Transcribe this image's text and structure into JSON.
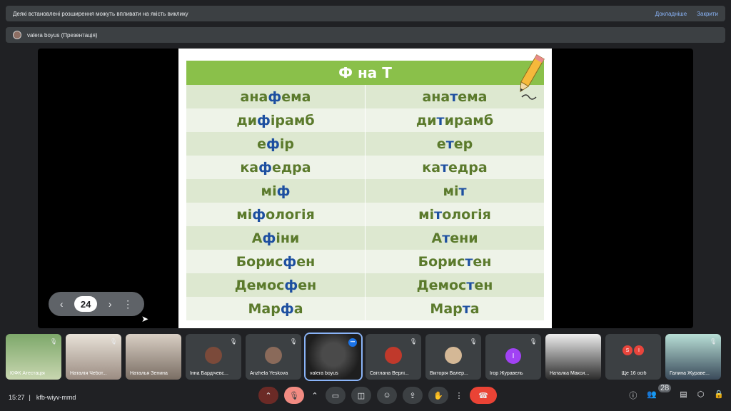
{
  "notice": {
    "message": "Деякі встановлені розширення можуть впливати на якість виклику",
    "details": "Докладніше",
    "close": "Закрити"
  },
  "presenter": {
    "label": "valera boyus (Презентація)"
  },
  "slide": {
    "title": "Ф на Т",
    "rows": [
      {
        "left_pre": "ана",
        "left_hl": "ф",
        "left_post": "ема",
        "right_pre": "ана",
        "right_hl": "т",
        "right_post": "ема"
      },
      {
        "left_pre": "ди",
        "left_hl": "ф",
        "left_post": "ірамб",
        "right_pre": "ди",
        "right_hl": "т",
        "right_post": "ирамб"
      },
      {
        "left_pre": "е",
        "left_hl": "ф",
        "left_post": "ір",
        "right_pre": "е",
        "right_hl": "т",
        "right_post": "ер"
      },
      {
        "left_pre": "ка",
        "left_hl": "ф",
        "left_post": "едра",
        "right_pre": "ка",
        "right_hl": "т",
        "right_post": "едра"
      },
      {
        "left_pre": "мі",
        "left_hl": "ф",
        "left_post": "",
        "right_pre": "мі",
        "right_hl": "т",
        "right_post": ""
      },
      {
        "left_pre": "мі",
        "left_hl": "ф",
        "left_post": "ологія",
        "right_pre": "мі",
        "right_hl": "т",
        "right_post": "ологія"
      },
      {
        "left_pre": "А",
        "left_hl": "ф",
        "left_post": "іни",
        "right_pre": "А",
        "right_hl": "т",
        "right_post": "ени"
      },
      {
        "left_pre": "Борис",
        "left_hl": "ф",
        "left_post": "ен",
        "right_pre": "Борис",
        "right_hl": "т",
        "right_post": "ен"
      },
      {
        "left_pre": "Демос",
        "left_hl": "ф",
        "left_post": "ен",
        "right_pre": "Демос",
        "right_hl": "т",
        "right_post": "ен"
      },
      {
        "left_pre": "Мар",
        "left_hl": "ф",
        "left_post": "а",
        "right_pre": "Мар",
        "right_hl": "т",
        "right_post": "а"
      }
    ]
  },
  "pager": {
    "page": "24",
    "prev_icon": "chevron-left-icon",
    "next_icon": "chevron-right-icon",
    "menu_icon": "more-vert-icon"
  },
  "participants": [
    {
      "name": "КІФК Атестація"
    },
    {
      "name": "Наталія Чебот..."
    },
    {
      "name": "Наталья Зенина"
    },
    {
      "name": "Інна Бардічевс..."
    },
    {
      "name": "Anzhela Yeskova"
    },
    {
      "name": "valera boyus"
    },
    {
      "name": "Світлана Верлі..."
    },
    {
      "name": "Вікторія Валер..."
    },
    {
      "name": "Ігор Журавель",
      "initial": "І"
    },
    {
      "name": "Наталка Макси..."
    },
    {
      "name": "Ще 16 осіб",
      "initials": [
        "S",
        "І"
      ]
    },
    {
      "name": "Галина Жураве..."
    }
  ],
  "footer": {
    "time": "15:27",
    "separator": "|",
    "code": "kfb-wiyv-mmd",
    "people_count": "28"
  },
  "colors": {
    "accent": "#8ab4f8",
    "end_call": "#ea4335",
    "slide_header": "#8ac04a",
    "highlight_letter": "#1d4fa0"
  }
}
